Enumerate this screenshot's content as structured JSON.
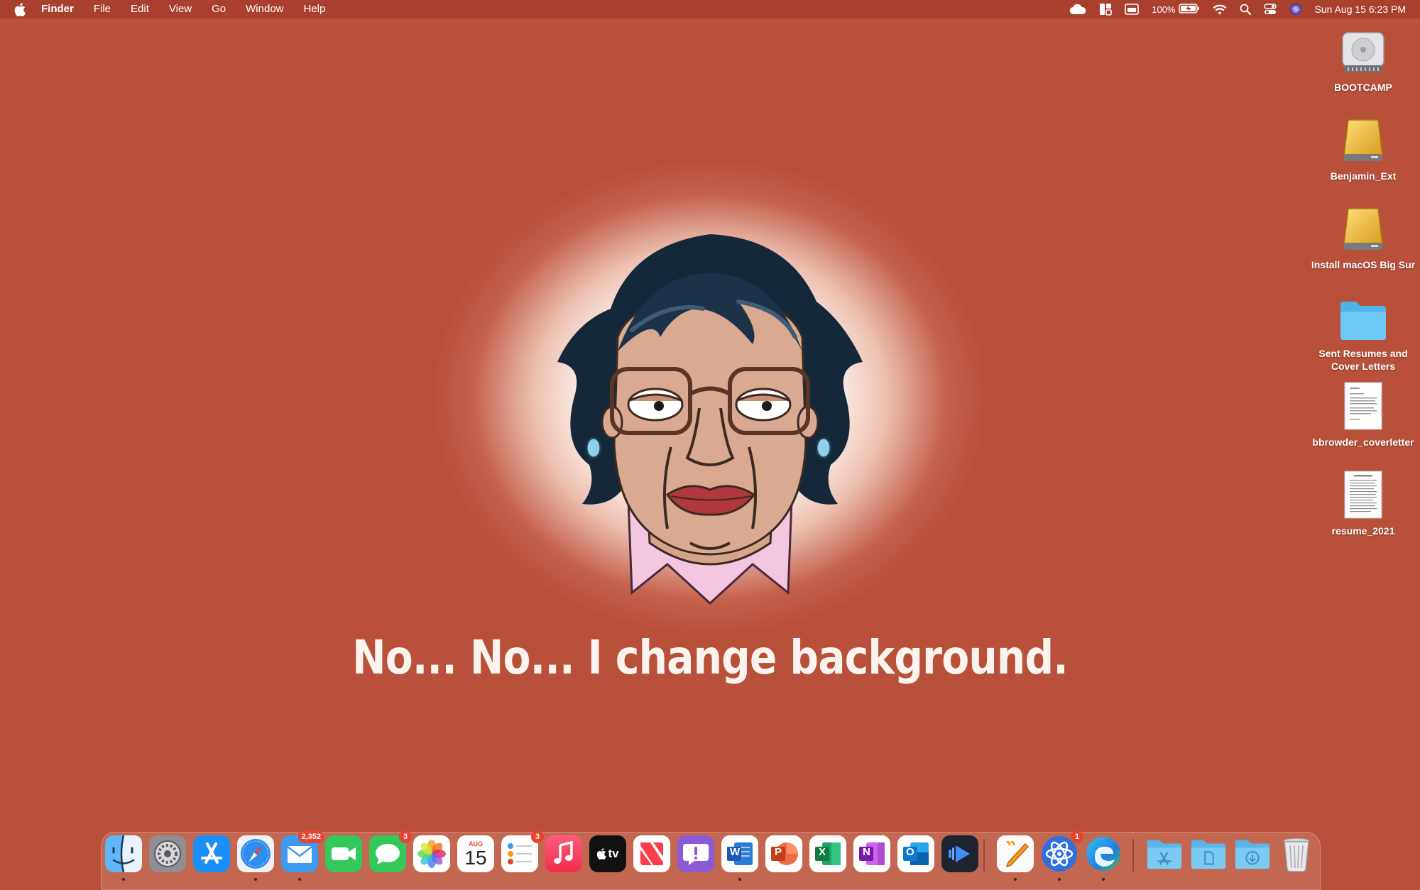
{
  "menubar": {
    "app_name": "Finder",
    "items": [
      "File",
      "Edit",
      "View",
      "Go",
      "Window",
      "Help"
    ],
    "battery_percent": "100%",
    "datetime": "Sun Aug 15  6:23 PM"
  },
  "wallpaper": {
    "caption": "No... No... I change background."
  },
  "desktop": {
    "items": [
      {
        "label": "BOOTCAMP",
        "icon": "internal-drive-icon"
      },
      {
        "label": "Benjamin_Ext",
        "icon": "external-drive-icon"
      },
      {
        "label": "Install macOS Big Sur",
        "icon": "external-drive-icon"
      },
      {
        "label": "Sent Resumes and Cover Letters",
        "icon": "folder-icon"
      },
      {
        "label": "bbrowder_coverletter",
        "icon": "document-icon"
      },
      {
        "label": "resume_2021",
        "icon": "document-icon"
      }
    ]
  },
  "dock": {
    "apps": [
      {
        "name": "Finder",
        "running": true
      },
      {
        "name": "System Preferences",
        "running": false
      },
      {
        "name": "App Store",
        "running": false
      },
      {
        "name": "Safari",
        "running": true
      },
      {
        "name": "Mail",
        "running": true,
        "badge": "2,352"
      },
      {
        "name": "FaceTime",
        "running": false
      },
      {
        "name": "Messages",
        "running": false,
        "badge": "3"
      },
      {
        "name": "Photos",
        "running": false
      },
      {
        "name": "Calendar",
        "running": false,
        "month": "AUG",
        "day": "15"
      },
      {
        "name": "Reminders",
        "running": false,
        "badge": "3"
      },
      {
        "name": "Music",
        "running": false
      },
      {
        "name": "TV",
        "running": false,
        "label": "tv"
      },
      {
        "name": "News",
        "running": false
      },
      {
        "name": "Feedback Assistant",
        "running": false
      },
      {
        "name": "Microsoft Word",
        "running": true,
        "letter": "W"
      },
      {
        "name": "Microsoft PowerPoint",
        "running": false,
        "letter": "P"
      },
      {
        "name": "Microsoft Excel",
        "running": false,
        "letter": "X"
      },
      {
        "name": "Microsoft OneNote",
        "running": false,
        "letter": "N"
      },
      {
        "name": "Microsoft Outlook",
        "running": false,
        "letter": "O"
      },
      {
        "name": "Movie Player",
        "running": false
      },
      {
        "name": "Pages",
        "running": true
      },
      {
        "name": "Atom-like App",
        "running": true,
        "badge": "1"
      },
      {
        "name": "Microsoft Edge",
        "running": true
      },
      {
        "name": "Applications",
        "running": false
      },
      {
        "name": "Documents",
        "running": false
      },
      {
        "name": "Downloads",
        "running": false
      },
      {
        "name": "Trash",
        "running": false
      }
    ]
  },
  "colors": {
    "wallpaper": "#b9503a",
    "menubar": "#a9402d",
    "badge": "#e8432f"
  }
}
